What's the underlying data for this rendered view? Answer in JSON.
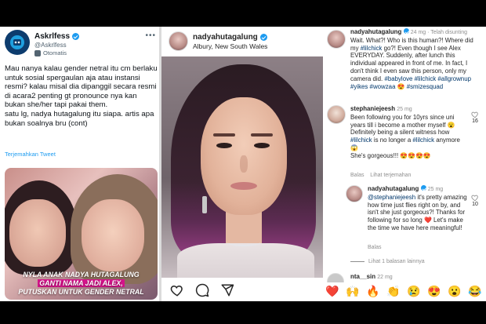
{
  "tweet": {
    "name": "Askrlfess",
    "handle": "@Askrlfess",
    "automated": "Otomatis",
    "body": [
      "Mau nanya kalau gender netral itu cm berlaku untuk sosial spergaulan aja atau instansi resmi? kalau misal dia dipanggil secara resmi di acara2 penting gt pronounce nya kan bukan she/her tapi pakai them.",
      "satu lg, nadya hutagalung itu siapa. artis apa bukan soalnya bru (cont)"
    ],
    "translate": "Terjemahkan Tweet",
    "image_caption_line1": "NYLA ANAK NADYA HUTAGALUNG",
    "image_caption_line2": "GANTI NAMA JADI ALEX,",
    "image_caption_line3": "PUTUSKAN UNTUK GENDER NETRAL"
  },
  "post": {
    "username": "nadyahutagalung",
    "location": "Albury, New South Wales"
  },
  "comments": [
    {
      "user": "nadyahutagalung",
      "meta": "24 mg · Telah disunting",
      "text": "Wait. What?! Who is this human?! Where did my",
      "tag1": "#lilchick",
      "text2": "go?! Even though I see Alex EVERYDAY. Suddenly, after lunch this individual appeared in front of me. In fact, I don't think I even saw this person, only my camera did.",
      "tags": "#babylove #lilchick #allgrownup #yikes #wowzaa",
      "emoji": "😍",
      "tags2": "#smizesquad"
    },
    {
      "user": "stephaniejeesh",
      "meta": "25 mg",
      "line1": "Been following you for 10yrs since uni years till i become a mother myself",
      "emoji1": "😮",
      "line2": "Definitely being a silent witness how",
      "tag": "#lilchick",
      "line2b": "is no longer a",
      "tag2": "#lilchick",
      "line2c": "anymore",
      "emoji2": "😱",
      "line3": "She's gorgeous!!!",
      "emoji3": "😍😍😍😍",
      "likes": "16",
      "reply_label": "Balas",
      "translate_label": "Lihat terjemahan"
    },
    {
      "user": "nadyahutagalung",
      "meta": "25 mg",
      "mention": "@stephaniejeesh",
      "text": "it's pretty amazing how time just flies right on by, and isn't she just gorgeous?! Thanks for following for so long",
      "emoji_heart": "❤️",
      "text2": "Let's make the time we have here meaningful!",
      "likes": "10",
      "reply_label": "Balas"
    }
  ],
  "view_replies": "Lihat 1 balasan lainnya",
  "next_comment": {
    "user": "nta__sin",
    "meta": "22 mg"
  },
  "emoji_bar": [
    "❤️",
    "🙌",
    "🔥",
    "👏",
    "😢",
    "😍",
    "😮",
    "😂"
  ]
}
